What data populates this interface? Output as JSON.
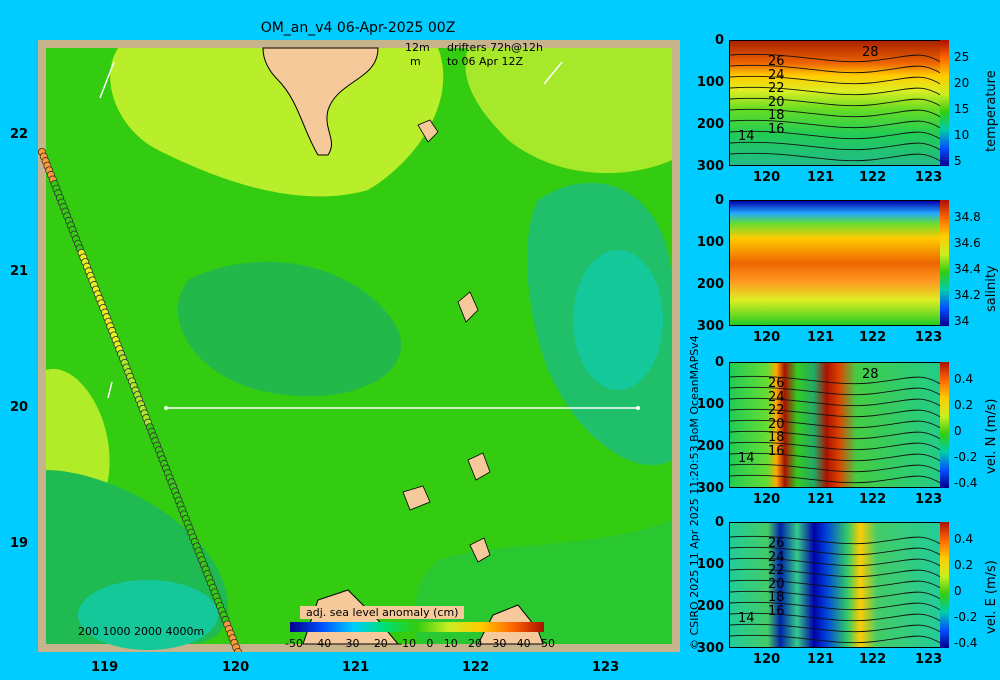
{
  "title": "OM_an_v4  06-Apr-2025 00Z",
  "map": {
    "x_ticks": [
      "119",
      "120",
      "121",
      "122",
      "123"
    ],
    "y_ticks": [
      "22",
      "21",
      "20",
      "19"
    ],
    "legend_line1_a": "12m",
    "legend_line1_b": "drifters 72h@12h",
    "legend_line2_a": "m",
    "legend_line2_b": "to 06 Apr 12Z",
    "depth_labels": "200  1000  2000  4000m",
    "colorbar_title": "adj. sea level anomaly (cm)",
    "colorbar_ticks": [
      "-50",
      "-40",
      "-30",
      "-20",
      "-10",
      "0",
      "10",
      "20",
      "30",
      "40",
      "50"
    ],
    "colors": {
      "background": "#00ccff",
      "land": "#f5c99a",
      "sea_base": "#33cc11",
      "frame": "#c8b48c"
    }
  },
  "credit": "© CSIRO 2025   11 Apr 2025 11:20:53 BoM OceanMAPSv4",
  "panels": [
    {
      "ylabel": "temperature",
      "y_ticks": [
        "0",
        "100",
        "200",
        "300"
      ],
      "x_ticks": [
        "120",
        "121",
        "122",
        "123"
      ],
      "cbar_ticks": [
        "25",
        "20",
        "15",
        "10",
        "5"
      ],
      "contours": [
        "26",
        "24",
        "22",
        "20",
        "18",
        "16",
        "14"
      ],
      "extra": "28"
    },
    {
      "ylabel": "salinity",
      "y_ticks": [
        "0",
        "100",
        "200",
        "300"
      ],
      "x_ticks": [
        "120",
        "121",
        "122",
        "123"
      ],
      "cbar_ticks": [
        "34.8",
        "34.6",
        "34.4",
        "34.2",
        "34"
      ]
    },
    {
      "ylabel": "vel. N (m/s)",
      "y_ticks": [
        "0",
        "100",
        "200",
        "300"
      ],
      "x_ticks": [
        "120",
        "121",
        "122",
        "123"
      ],
      "cbar_ticks": [
        "0.4",
        "0.2",
        "0",
        "-0.2",
        "-0.4"
      ],
      "contours": [
        "26",
        "24",
        "22",
        "20",
        "18",
        "16",
        "14"
      ],
      "extra": "28"
    },
    {
      "ylabel": "vel. E (m/s)",
      "y_ticks": [
        "0",
        "100",
        "200",
        "300"
      ],
      "x_ticks": [
        "120",
        "121",
        "122",
        "123"
      ],
      "cbar_ticks": [
        "0.4",
        "0.2",
        "0",
        "-0.2",
        "-0.4"
      ],
      "contours": [
        "26",
        "24",
        "22",
        "20",
        "18",
        "16",
        "14"
      ]
    }
  ],
  "chart_data": [
    {
      "type": "heatmap",
      "title": "OM_an_v4  06-Apr-2025 00Z",
      "xlim": [
        118.5,
        123.5
      ],
      "ylim": [
        18.3,
        22.7
      ],
      "colorbar": "adj. sea level anomaly (cm)",
      "colorbar_range": [
        -50,
        50
      ],
      "section_line": {
        "lon": [
          119.5,
          123.2
        ],
        "lat": 20.0
      }
    },
    {
      "type": "heatmap",
      "ylabel": "temperature",
      "xlim": [
        119.5,
        123.2
      ],
      "ylim": [
        300,
        0
      ],
      "colorbar_range": [
        2,
        28
      ]
    },
    {
      "type": "heatmap",
      "ylabel": "salinity",
      "xlim": [
        119.5,
        123.2
      ],
      "ylim": [
        300,
        0
      ],
      "colorbar_range": [
        33.9,
        34.9
      ]
    },
    {
      "type": "heatmap",
      "ylabel": "vel. N (m/s)",
      "xlim": [
        119.5,
        123.2
      ],
      "ylim": [
        300,
        0
      ],
      "colorbar_range": [
        -0.4,
        0.4
      ]
    },
    {
      "type": "heatmap",
      "ylabel": "vel. E (m/s)",
      "xlim": [
        119.5,
        123.2
      ],
      "ylim": [
        300,
        0
      ],
      "colorbar_range": [
        -0.4,
        0.4
      ]
    }
  ]
}
